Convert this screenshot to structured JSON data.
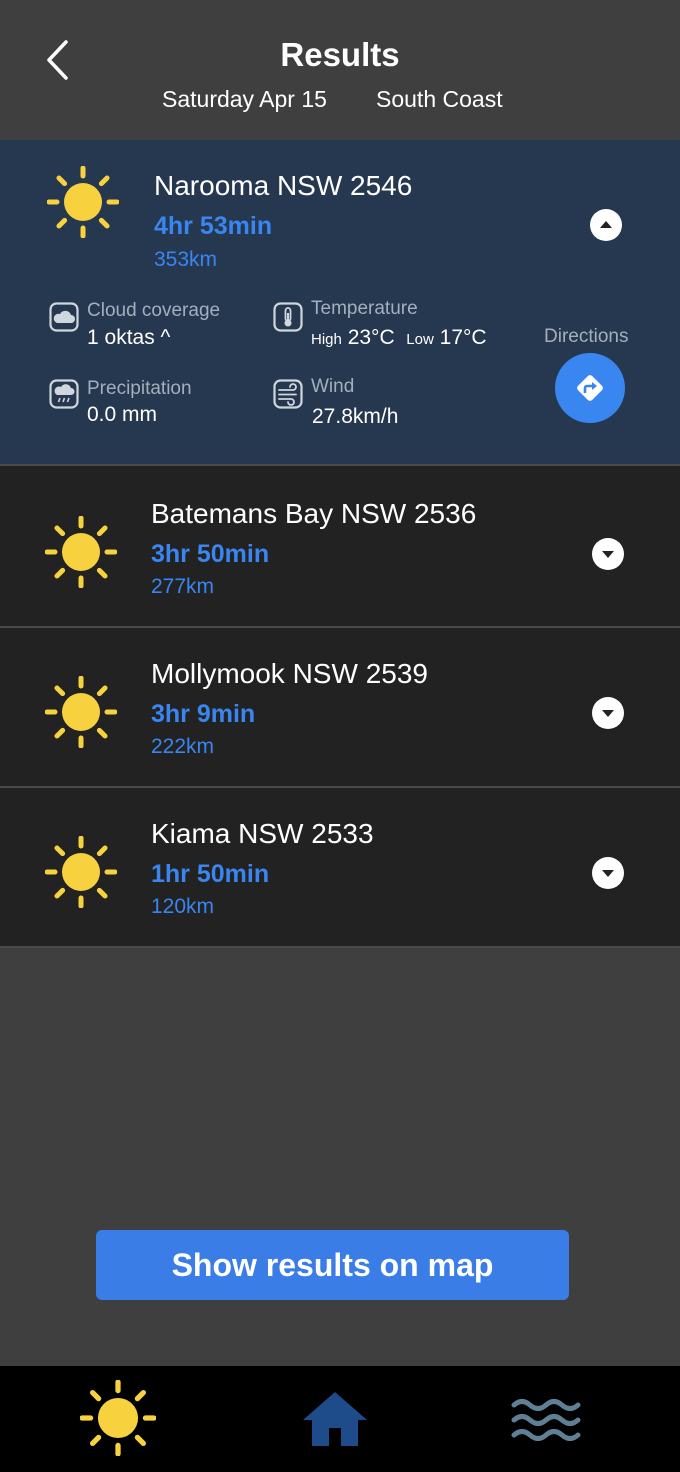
{
  "header": {
    "title": "Results",
    "date": "Saturday Apr 15",
    "region": "South Coast"
  },
  "results": [
    {
      "location": "Narooma NSW 2546",
      "duration": "4hr 53min",
      "distance": "353km",
      "icon": "sun-icon",
      "expanded": true,
      "details": {
        "cloud_label": "Cloud coverage",
        "cloud_value": "1 oktas ^",
        "temp_label": "Temperature",
        "temp_high_label": "High",
        "temp_high": "23°C",
        "temp_low_label": "Low",
        "temp_low": "17°C",
        "precip_label": "Precipitation",
        "precip_value": "0.0 mm",
        "wind_label": "Wind",
        "wind_value": "27.8km/h",
        "directions_label": "Directions"
      }
    },
    {
      "location": "Batemans Bay NSW 2536",
      "duration": "3hr 50min",
      "distance": "277km",
      "icon": "sun-icon",
      "expanded": false
    },
    {
      "location": "Mollymook NSW 2539",
      "duration": "3hr 9min",
      "distance": "222km",
      "icon": "sun-icon",
      "expanded": false
    },
    {
      "location": "Kiama NSW 2533",
      "duration": "1hr 50min",
      "distance": "120km",
      "icon": "sun-icon",
      "expanded": false
    }
  ],
  "map_button": "Show results on map",
  "nav": [
    "sun-icon",
    "home-icon",
    "waves-icon"
  ],
  "colors": {
    "accent": "#3a86f0",
    "sun": "#f7d23e",
    "expanded_card": "#26384f",
    "card": "#222222",
    "background": "#3f3f3f",
    "home_icon": "#1e4c8a",
    "waves_icon": "#5f7f95"
  }
}
